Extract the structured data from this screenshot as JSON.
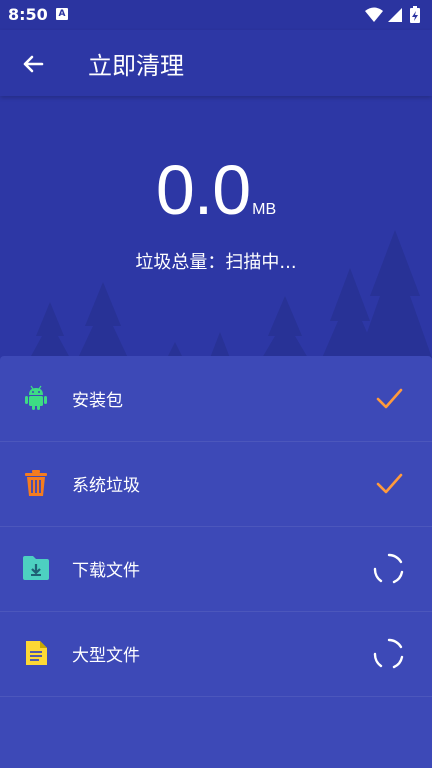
{
  "status_bar": {
    "time": "8:50",
    "notification_letter": "A"
  },
  "toolbar": {
    "title": "立即清理",
    "back_icon": "arrow-left-icon"
  },
  "summary": {
    "size_value": "0.0",
    "size_unit": "MB",
    "total_text": "垃圾总量：扫描中..."
  },
  "categories": [
    {
      "label": "安装包",
      "icon": "android-icon",
      "status": "done",
      "icon_color": "#3ddc84"
    },
    {
      "label": "系统垃圾",
      "icon": "trash-icon",
      "status": "done",
      "icon_color": "#f57c1f"
    },
    {
      "label": "下载文件",
      "icon": "download-folder-icon",
      "status": "scanning",
      "icon_color": "#4dd0c1"
    },
    {
      "label": "大型文件",
      "icon": "document-icon",
      "status": "scanning",
      "icon_color": "#fdd835"
    }
  ],
  "colors": {
    "background": "#2d37a5",
    "panel": "#3d49b7",
    "check": "#ff9a3c"
  }
}
